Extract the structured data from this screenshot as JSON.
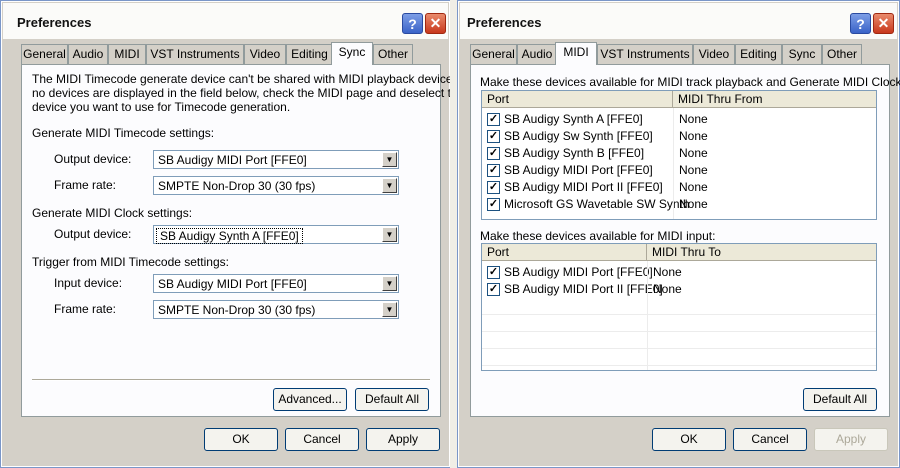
{
  "left": {
    "title": "Preferences",
    "tabs": [
      "General",
      "Audio",
      "MIDI",
      "VST Instruments",
      "Video",
      "Editing",
      "Sync",
      "Other"
    ],
    "selected_tab": "Sync",
    "description": [
      "The MIDI Timecode generate device can't be shared with MIDI playback devices. If",
      "no devices are displayed in the field below, check the MIDI page and deselect the",
      "device you want to use for Timecode generation."
    ],
    "gen_timecode": {
      "heading": "Generate MIDI Timecode settings:",
      "output_label": "Output device:",
      "output_value": "SB Audigy MIDI Port [FFE0]",
      "frame_label": "Frame rate:",
      "frame_value": "SMPTE Non-Drop 30 (30 fps)"
    },
    "gen_clock": {
      "heading": "Generate MIDI Clock settings:",
      "output_label": "Output device:",
      "output_value": "SB Audigy Synth A [FFE0]"
    },
    "trigger": {
      "heading": "Trigger from MIDI Timecode settings:",
      "input_label": "Input device:",
      "input_value": "SB Audigy MIDI Port [FFE0]",
      "frame_label": "Frame rate:",
      "frame_value": "SMPTE Non-Drop 30 (30 fps)"
    },
    "advanced_label": "Advanced...",
    "default_all_label": "Default All",
    "ok_label": "OK",
    "cancel_label": "Cancel",
    "apply_label": "Apply"
  },
  "right": {
    "title": "Preferences",
    "tabs": [
      "General",
      "Audio",
      "MIDI",
      "VST Instruments",
      "Video",
      "Editing",
      "Sync",
      "Other"
    ],
    "selected_tab": "MIDI",
    "playback_heading": "Make these devices available for MIDI track playback and Generate MIDI Clock:",
    "playback_columns": [
      "Port",
      "MIDI Thru From"
    ],
    "playback_rows": [
      {
        "port": "SB Audigy Synth A [FFE0]",
        "thru": "None",
        "checked": true
      },
      {
        "port": "SB Audigy Sw Synth [FFE0]",
        "thru": "None",
        "checked": true
      },
      {
        "port": "SB Audigy Synth B [FFE0]",
        "thru": "None",
        "checked": true
      },
      {
        "port": "SB Audigy MIDI Port [FFE0]",
        "thru": "None",
        "checked": true
      },
      {
        "port": "SB Audigy MIDI Port II [FFE0]",
        "thru": "None",
        "checked": true
      },
      {
        "port": "Microsoft GS Wavetable SW Synth",
        "thru": "None",
        "checked": true
      }
    ],
    "input_heading": "Make these devices available for MIDI input:",
    "input_columns": [
      "Port",
      "MIDI Thru To"
    ],
    "input_rows": [
      {
        "port": "SB Audigy MIDI Port [FFE0]",
        "thru": "None",
        "checked": true
      },
      {
        "port": "SB Audigy MIDI Port II [FFE0]",
        "thru": "None",
        "checked": true
      }
    ],
    "default_all_label": "Default All",
    "ok_label": "OK",
    "cancel_label": "Cancel",
    "apply_label": "Apply",
    "apply_disabled": true
  }
}
